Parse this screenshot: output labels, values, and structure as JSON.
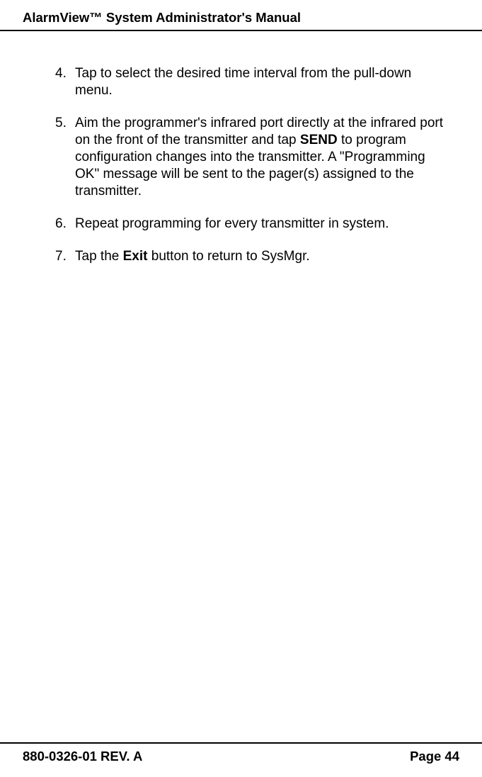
{
  "header": {
    "title": "AlarmView™ System Administrator's Manual"
  },
  "items": [
    {
      "num": "4.",
      "parts": [
        {
          "text": "Tap to select the desired time interval from the pull-down menu.",
          "bold": false
        }
      ]
    },
    {
      "num": "5.",
      "parts": [
        {
          "text": "Aim the programmer's infrared port directly at the infrared port on the front of the transmitter and tap ",
          "bold": false
        },
        {
          "text": "SEND",
          "bold": true
        },
        {
          "text": " to program configuration changes into the transmitter. A \"Programming OK\" message will be sent to the pager(s) assigned to the transmitter.",
          "bold": false
        }
      ]
    },
    {
      "num": "6.",
      "parts": [
        {
          "text": "Repeat programming for every transmitter in system.",
          "bold": false
        }
      ]
    },
    {
      "num": "7.",
      "parts": [
        {
          "text": "Tap the ",
          "bold": false
        },
        {
          "text": "Exit",
          "bold": true
        },
        {
          "text": " button to return to SysMgr.",
          "bold": false
        }
      ]
    }
  ],
  "footer": {
    "left": "880-0326-01 REV. A",
    "right": "Page 44"
  }
}
